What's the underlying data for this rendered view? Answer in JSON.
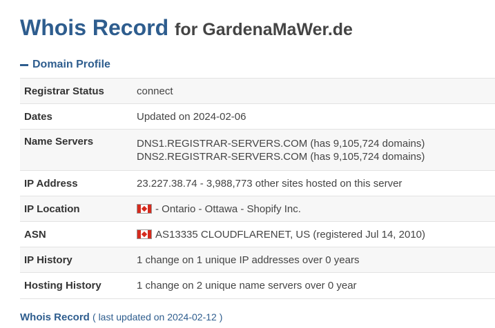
{
  "header": {
    "title": "Whois Record",
    "for_text": "for GardenaMaWer.de"
  },
  "section": {
    "toggle_label": "Domain Profile"
  },
  "profile": {
    "registrar_status": {
      "label": "Registrar Status",
      "value": "connect"
    },
    "dates": {
      "label": "Dates",
      "value": "Updated on 2024-02-06"
    },
    "name_servers": {
      "label": "Name Servers",
      "values": [
        "DNS1.REGISTRAR-SERVERS.COM (has 9,105,724 domains)",
        "DNS2.REGISTRAR-SERVERS.COM (has 9,105,724 domains)"
      ]
    },
    "ip_address": {
      "label": "IP Address",
      "value": "23.227.38.74 - 3,988,773 other sites hosted on this server"
    },
    "ip_location": {
      "label": "IP Location",
      "value": "- Ontario - Ottawa - Shopify Inc.",
      "flag": "canada-flag-icon"
    },
    "asn": {
      "label": "ASN",
      "value": "AS13335 CLOUDFLARENET, US (registered Jul 14, 2010)",
      "flag": "canada-flag-icon"
    },
    "ip_history": {
      "label": "IP History",
      "value": "1 change on 1 unique IP addresses over 0 years"
    },
    "hosting_history": {
      "label": "Hosting History",
      "value": "1 change on 2 unique name servers over 0 year"
    }
  },
  "footer": {
    "link_label": "Whois Record",
    "updated_text": "( last updated on 2024-02-12 )"
  },
  "colors": {
    "accent": "#2e5d8e",
    "row_alt": "#f7f7f7",
    "border": "#e2e2e2",
    "flag_red": "#d52b1e"
  }
}
